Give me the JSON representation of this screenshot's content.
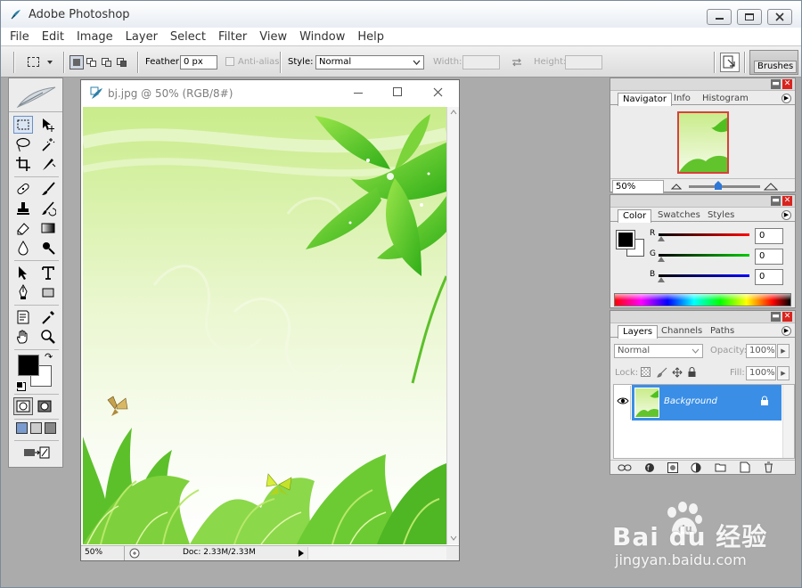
{
  "app": {
    "title": "Adobe Photoshop"
  },
  "menu": [
    "File",
    "Edit",
    "Image",
    "Layer",
    "Select",
    "Filter",
    "View",
    "Window",
    "Help"
  ],
  "options": {
    "feather_label": "Feather:",
    "feather_value": "0 px",
    "antialias_label": "Anti-alias",
    "style_label": "Style:",
    "style_value": "Normal",
    "width_label": "Width:",
    "height_label": "Height:",
    "brushes_tab": "Brushes"
  },
  "document": {
    "title": "bj.jpg @ 50% (RGB/8#)",
    "zoom": "50%",
    "doc_info": "Doc: 2.33M/2.33M"
  },
  "navigator": {
    "tabs": [
      "Navigator",
      "Info",
      "Histogram"
    ],
    "zoom": "50%"
  },
  "color": {
    "tabs": [
      "Color",
      "Swatches",
      "Styles"
    ],
    "channels": [
      {
        "label": "R",
        "value": "0",
        "color": "#ff0000"
      },
      {
        "label": "G",
        "value": "0",
        "color": "#00cc00"
      },
      {
        "label": "B",
        "value": "0",
        "color": "#0000ff"
      }
    ]
  },
  "layers": {
    "tabs": [
      "Layers",
      "Channels",
      "Paths"
    ],
    "blend_mode": "Normal",
    "opacity_label": "Opacity:",
    "opacity_value": "100%",
    "lock_label": "Lock:",
    "fill_label": "Fill:",
    "fill_value": "100%",
    "layer_name": "Background"
  },
  "watermark": {
    "brand": "Bai du 经验",
    "url": "jingyan.baidu.com"
  },
  "colors": {
    "accent": "#3a8ee6",
    "close_red": "#d9241e"
  }
}
